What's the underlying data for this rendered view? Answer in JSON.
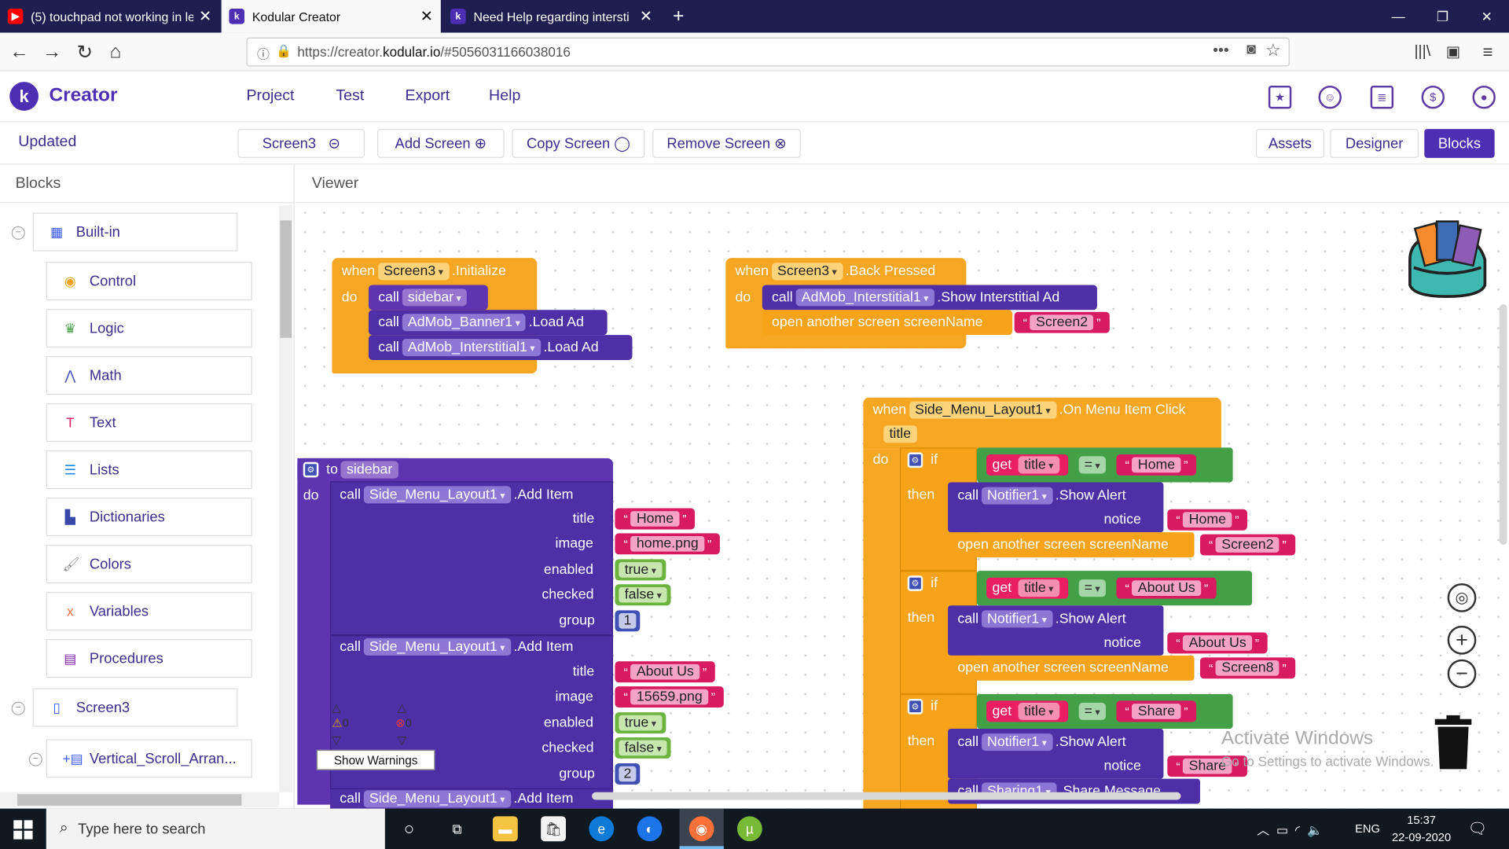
{
  "browser": {
    "tabs": [
      {
        "title": "(5) touchpad not working in len",
        "icon": "youtube-icon",
        "color": "#ff0000"
      },
      {
        "title": "Kodular Creator",
        "icon": "kodular-icon",
        "color": "#4d2fb4"
      },
      {
        "title": "Need Help regarding intersti",
        "icon": "kodular-icon",
        "color": "#4d2fb4"
      }
    ],
    "url_prefix": "https://creator.",
    "url_domain": "kodular.io",
    "url_suffix": "/#5056031166038016"
  },
  "app": {
    "brand": "Creator",
    "menu": [
      "Project",
      "Test",
      "Export",
      "Help"
    ]
  },
  "toolbar": {
    "status": "Updated",
    "screen": "Screen3",
    "add_screen": "Add Screen",
    "copy_screen": "Copy Screen",
    "remove_screen": "Remove Screen",
    "assets": "Assets",
    "designer": "Designer",
    "blocks": "Blocks"
  },
  "sidebar": {
    "title": "Blocks",
    "builtin": "Built-in",
    "items": [
      "Control",
      "Logic",
      "Math",
      "Text",
      "Lists",
      "Dictionaries",
      "Colors",
      "Variables",
      "Procedures"
    ],
    "screen": "Screen3",
    "component": "Vertical_Scroll_Arran..."
  },
  "viewer": {
    "title": "Viewer",
    "show_warnings": "Show Warnings",
    "warn_count": "0",
    "err_count": "0",
    "watermark1": "Activate Windows",
    "watermark2": "Go to Settings to activate Windows."
  },
  "blocks": {
    "when": "when",
    "do": "do",
    "call": "call",
    "to": "to",
    "if": "if",
    "then": "then",
    "get": "get",
    "eq": "=",
    "init_comp": "Screen3",
    "init_evt": ".Initialize",
    "sidebar_proc": "sidebar",
    "banner": "AdMob_Banner1",
    "inter": "AdMob_Interstitial1",
    "load_ad": ".Load Ad",
    "back_evt": ".Back Pressed",
    "show_inter": ".Show Interstitial Ad",
    "open_screen": "open another screen  screenName",
    "screen2": "Screen2",
    "screen8": "Screen8",
    "side_menu": "Side_Menu_Layout1",
    "add_item": ".Add Item",
    "on_click": ".On Menu Item Click",
    "param": "title",
    "lbl_title": "title",
    "lbl_image": "image",
    "lbl_enabled": "enabled",
    "lbl_checked": "checked",
    "lbl_group": "group",
    "home": "Home",
    "home_png": "home.png",
    "about": "About Us",
    "about_png": "15659.png",
    "true": "true",
    "false": "false",
    "g1": "1",
    "g2": "2",
    "notifier": "Notifier1",
    "show_alert": ".Show Alert",
    "notice": "notice",
    "share": "Share",
    "sharing": "Sharing1",
    "share_msg": ".Share Message"
  },
  "taskbar": {
    "search": "Type here to search",
    "lang": "ENG",
    "time": "15:37",
    "date": "22-09-2020"
  },
  "colors": {
    "event": "#f5a623",
    "procedure": "#5d35b0",
    "component": "#4f2fa6",
    "control": "#f6a31a",
    "logic": "#43a047",
    "text": "#d81b60"
  }
}
